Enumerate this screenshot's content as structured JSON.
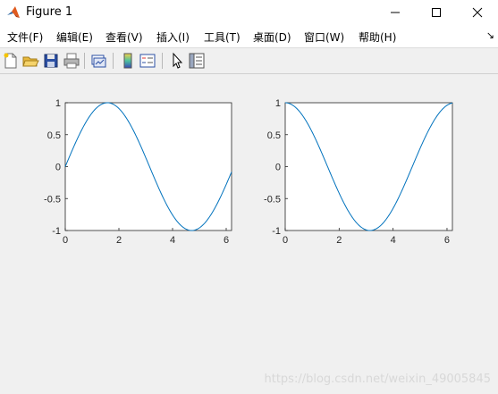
{
  "window": {
    "title": "Figure 1",
    "icon": "matlab-icon",
    "controls": [
      "minimize-icon",
      "maximize-icon",
      "close-icon"
    ]
  },
  "menu": {
    "items": [
      "文件(F)",
      "编辑(E)",
      "查看(V)",
      "插入(I)",
      "工具(T)",
      "桌面(D)",
      "窗口(W)",
      "帮助(H)"
    ],
    "overflow_icon": "chevron-arrow-icon"
  },
  "toolbar": {
    "buttons": [
      "new-figure-icon",
      "open-file-icon",
      "save-icon",
      "print-icon",
      "link-plot-icon",
      "colorbar-icon",
      "legend-icon",
      "edit-plot-icon",
      "property-inspector-icon"
    ]
  },
  "colors": {
    "line": "#0072bd",
    "axes_bg": "#ffffff",
    "figure_bg": "#f0f0f0"
  },
  "chart_data": [
    {
      "type": "line",
      "function": "sin(x)",
      "x": [
        0,
        0.393,
        0.785,
        1.178,
        1.571,
        1.963,
        2.356,
        2.749,
        3.142,
        3.534,
        3.927,
        4.32,
        4.712,
        5.105,
        5.498,
        5.89,
        6.2
      ],
      "y": [
        0,
        0.383,
        0.707,
        0.924,
        1,
        0.924,
        0.707,
        0.383,
        0,
        -0.383,
        -0.707,
        -0.924,
        -1,
        -0.924,
        -0.707,
        -0.383,
        -0.083
      ],
      "xlim": [
        0,
        6.2
      ],
      "ylim": [
        -1,
        1
      ],
      "xticks": [
        "0",
        "2",
        "4",
        "6"
      ],
      "yticks": [
        "1",
        "0.5",
        "0",
        "-0.5",
        "-1"
      ],
      "title": "",
      "xlabel": "",
      "ylabel": ""
    },
    {
      "type": "line",
      "function": "cos(x)",
      "x": [
        0,
        0.393,
        0.785,
        1.178,
        1.571,
        1.963,
        2.356,
        2.749,
        3.142,
        3.534,
        3.927,
        4.32,
        4.712,
        5.105,
        5.498,
        5.89,
        6.2
      ],
      "y": [
        1,
        0.924,
        0.707,
        0.383,
        0,
        -0.383,
        -0.707,
        -0.924,
        -1,
        -0.924,
        -0.707,
        -0.383,
        0,
        0.383,
        0.707,
        0.924,
        0.997
      ],
      "xlim": [
        0,
        6.2
      ],
      "ylim": [
        -1,
        1
      ],
      "xticks": [
        "0",
        "2",
        "4",
        "6"
      ],
      "yticks": [
        "1",
        "0.5",
        "0",
        "-0.5",
        "-1"
      ],
      "title": "",
      "xlabel": "",
      "ylabel": ""
    }
  ],
  "watermark": "https://blog.csdn.net/weixin_49005845"
}
